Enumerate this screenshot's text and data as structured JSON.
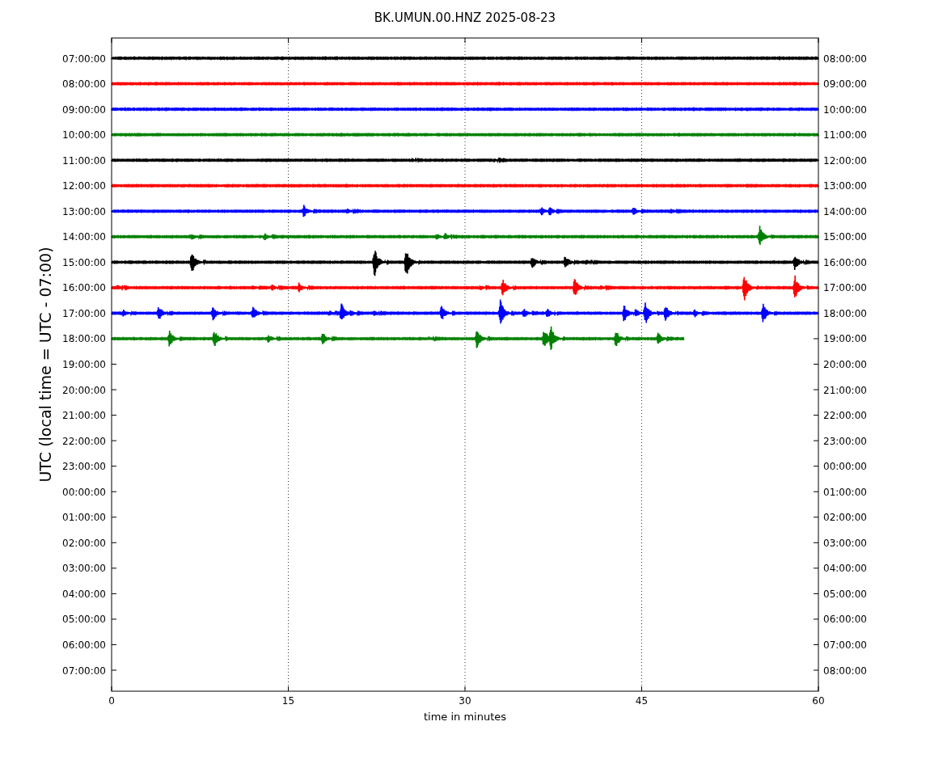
{
  "title": "BK.UMUN.00.HNZ 2025-08-23",
  "y_axis": {
    "label": "UTC (local time = UTC - 07:00)",
    "left_labels": [
      "07:00:00",
      "08:00:00",
      "09:00:00",
      "10:00:00",
      "11:00:00",
      "12:00:00",
      "13:00:00",
      "14:00:00",
      "15:00:00",
      "16:00:00",
      "17:00:00",
      "18:00:00",
      "19:00:00",
      "20:00:00",
      "21:00:00",
      "22:00:00",
      "23:00:00",
      "00:00:00",
      "01:00:00",
      "02:00:00",
      "03:00:00",
      "04:00:00",
      "05:00:00",
      "06:00:00",
      "07:00:00"
    ],
    "right_labels": [
      "08:00:00",
      "09:00:00",
      "10:00:00",
      "11:00:00",
      "12:00:00",
      "13:00:00",
      "14:00:00",
      "15:00:00",
      "16:00:00",
      "17:00:00",
      "18:00:00",
      "19:00:00",
      "20:00:00",
      "21:00:00",
      "22:00:00",
      "23:00:00",
      "00:00:00",
      "01:00:00",
      "02:00:00",
      "03:00:00",
      "04:00:00",
      "05:00:00",
      "06:00:00",
      "07:00:00",
      "08:00:00"
    ]
  },
  "x_axis": {
    "label": "time in minutes",
    "ticks": [
      "0",
      "15",
      "30",
      "45",
      "60"
    ]
  },
  "traces": [
    {
      "color": "#000000"
    },
    {
      "color": "#ff0000"
    },
    {
      "color": "#0000ff"
    },
    {
      "color": "#008000"
    },
    {
      "color": "#000000"
    },
    {
      "color": "#ff0000"
    },
    {
      "color": "#0000ff"
    },
    {
      "color": "#008000"
    },
    {
      "color": "#000000"
    },
    {
      "color": "#ff0000"
    },
    {
      "color": "#0000ff"
    },
    {
      "color": "#008000"
    }
  ]
}
